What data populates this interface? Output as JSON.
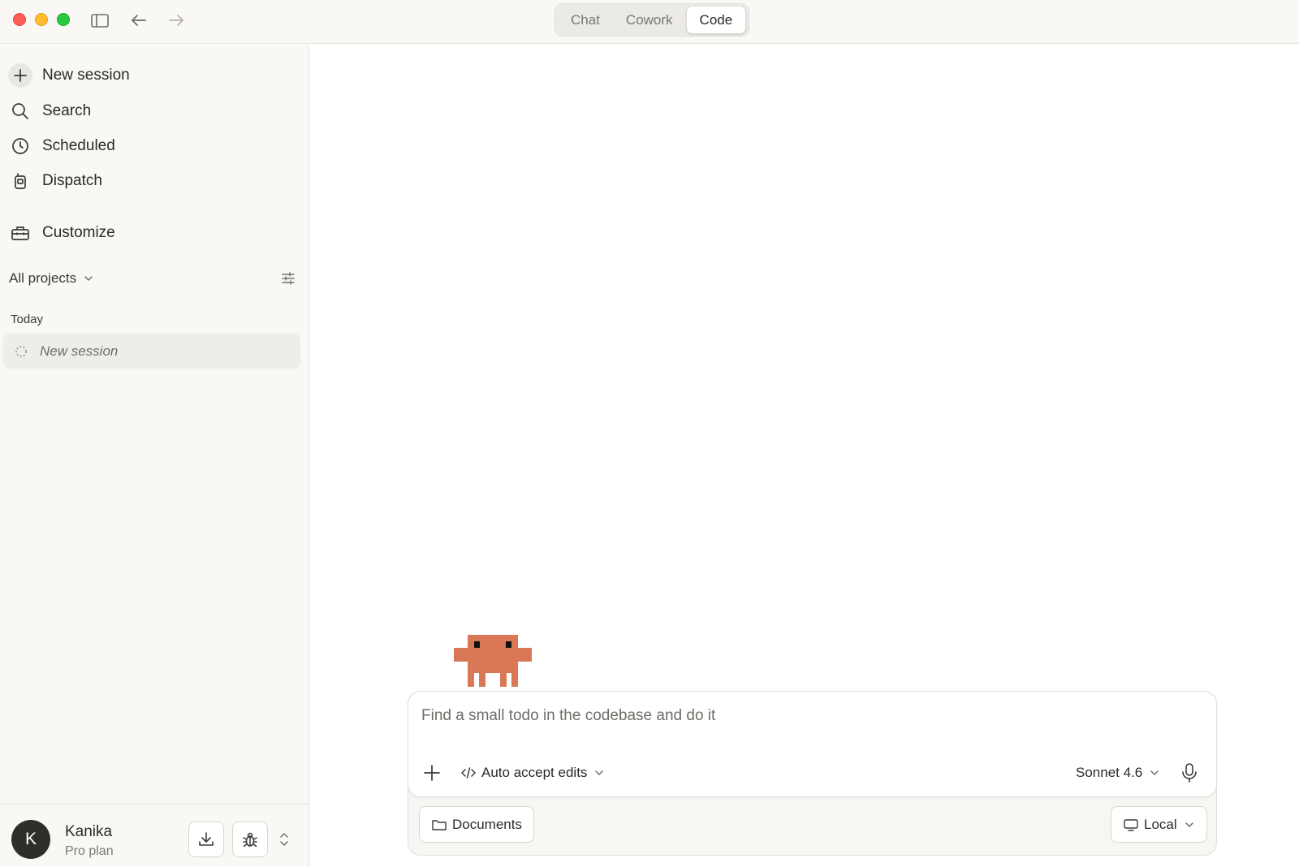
{
  "titlebar": {
    "tabs": [
      {
        "label": "Chat",
        "active": false
      },
      {
        "label": "Cowork",
        "active": false
      },
      {
        "label": "Code",
        "active": true
      }
    ]
  },
  "sidebar": {
    "nav": [
      {
        "label": "New session",
        "icon": "plus-icon"
      },
      {
        "label": "Search",
        "icon": "search-icon"
      },
      {
        "label": "Scheduled",
        "icon": "clock-icon"
      },
      {
        "label": "Dispatch",
        "icon": "dispatch-icon"
      },
      {
        "label": "Customize",
        "icon": "toolbox-icon"
      }
    ],
    "projects_filter": "All projects",
    "section_today": "Today",
    "sessions": [
      {
        "label": "New session"
      }
    ],
    "user": {
      "initial": "K",
      "name": "Kanika",
      "plan": "Pro plan"
    }
  },
  "composer": {
    "prompt": "Find a small todo in the codebase and do it",
    "accept_mode": "Auto accept edits",
    "model": "Sonnet 4.6",
    "folder": "Documents",
    "environment": "Local"
  },
  "colors": {
    "accent_mascot": "#d97757",
    "sidebar_bg": "#f9f8f5",
    "active_session_bg": "#efede7"
  }
}
